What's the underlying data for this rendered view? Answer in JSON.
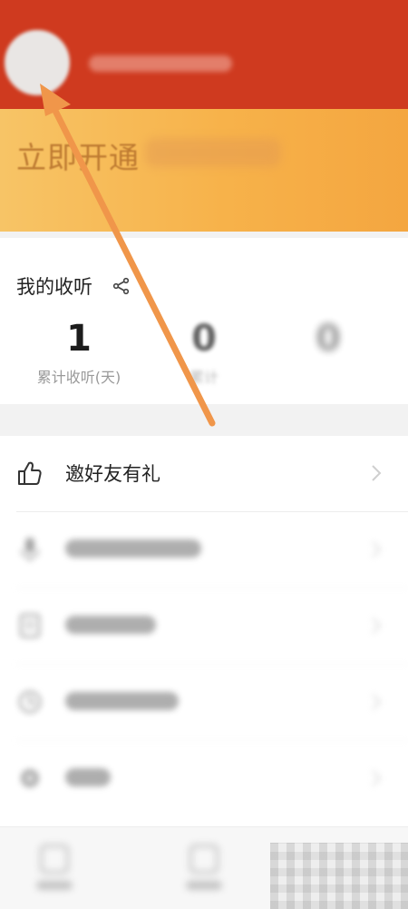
{
  "profile": {
    "avatar_icon": "avatar",
    "username": ""
  },
  "vip": {
    "text": "立即开通"
  },
  "listening": {
    "title": "我的收听",
    "share_icon": "share-icon",
    "stats": [
      {
        "value": "1",
        "label": "累计收听(天)"
      },
      {
        "value": "0",
        "label": "累计"
      },
      {
        "value": "0",
        "label": ""
      }
    ]
  },
  "menu": {
    "items": [
      {
        "label": "邀好友有礼",
        "icon": "thumbs-up-icon"
      },
      {
        "label": "",
        "icon": "microphone-icon"
      },
      {
        "label": "",
        "icon": "document-icon"
      },
      {
        "label": "",
        "icon": "clock-icon"
      },
      {
        "label": "",
        "icon": "settings-icon"
      }
    ]
  },
  "colors": {
    "header": "#cf3a1f",
    "vip_gradient_start": "#f7c466",
    "vip_gradient_end": "#f4a640",
    "annotation_arrow": "#f0964a"
  }
}
